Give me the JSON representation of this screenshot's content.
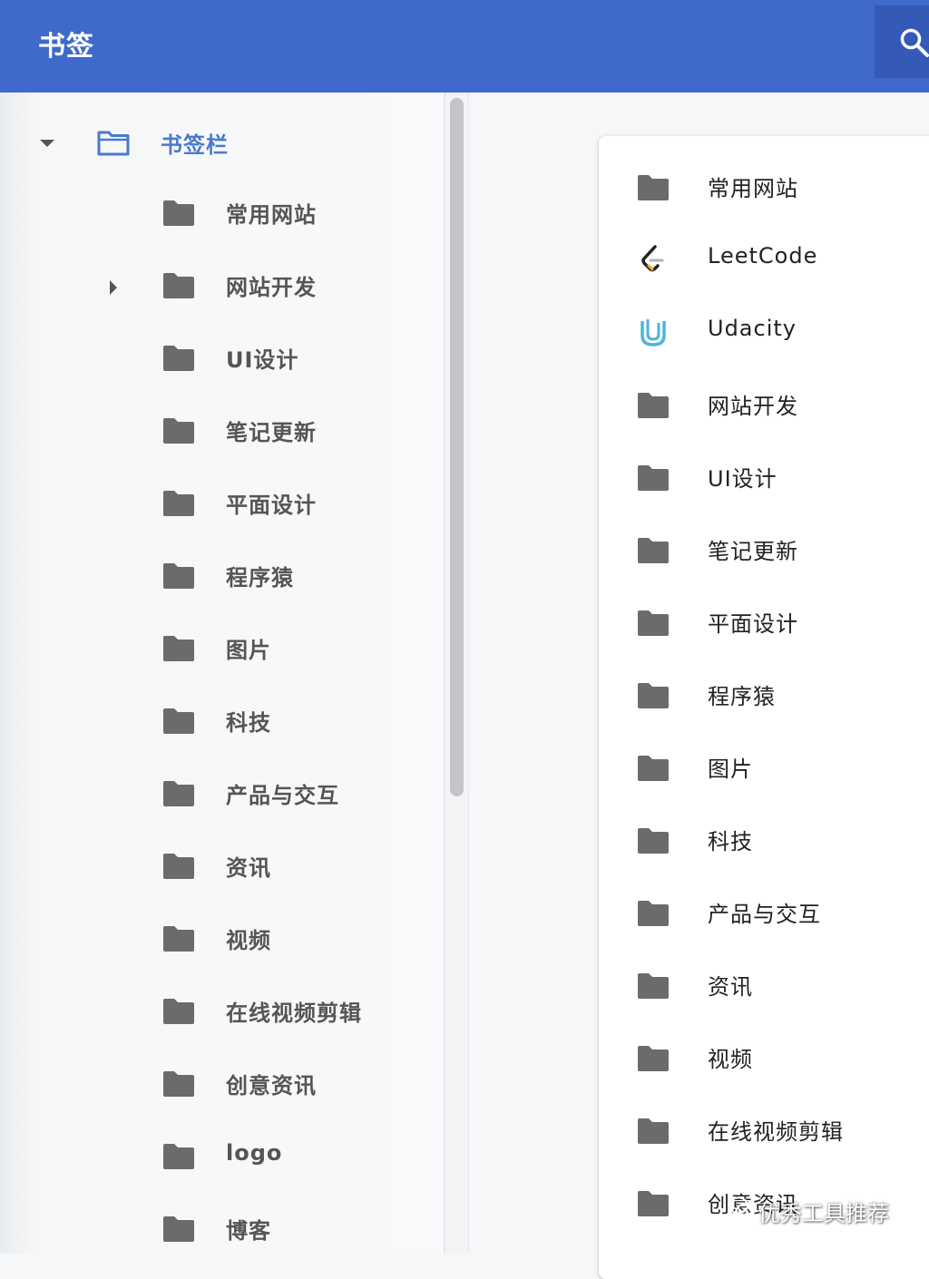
{
  "header": {
    "title": "书签"
  },
  "sidebar": {
    "root_label": "书签栏",
    "items": [
      {
        "label": "常用网站"
      },
      {
        "label": "网站开发",
        "expandable": true
      },
      {
        "label": "UI设计"
      },
      {
        "label": "笔记更新"
      },
      {
        "label": "平面设计"
      },
      {
        "label": "程序猿"
      },
      {
        "label": "图片"
      },
      {
        "label": "科技"
      },
      {
        "label": "产品与交互"
      },
      {
        "label": "资讯"
      },
      {
        "label": "视频"
      },
      {
        "label": "在线视频剪辑"
      },
      {
        "label": "创意资讯"
      },
      {
        "label": "logo"
      },
      {
        "label": "博客"
      }
    ]
  },
  "main": {
    "items": [
      {
        "label": "常用网站",
        "icon": "folder-icon"
      },
      {
        "label": "LeetCode",
        "icon": "leetcode-icon"
      },
      {
        "label": "Udacity",
        "icon": "udacity-icon"
      },
      {
        "label": "网站开发",
        "icon": "folder-icon"
      },
      {
        "label": "UI设计",
        "icon": "folder-icon"
      },
      {
        "label": "笔记更新",
        "icon": "folder-icon"
      },
      {
        "label": "平面设计",
        "icon": "folder-icon"
      },
      {
        "label": "程序猿",
        "icon": "folder-icon"
      },
      {
        "label": "图片",
        "icon": "folder-icon"
      },
      {
        "label": "科技",
        "icon": "folder-icon"
      },
      {
        "label": "产品与交互",
        "icon": "folder-icon"
      },
      {
        "label": "资讯",
        "icon": "folder-icon"
      },
      {
        "label": "视频",
        "icon": "folder-icon"
      },
      {
        "label": "在线视频剪辑",
        "icon": "folder-icon"
      },
      {
        "label": "创意资讯",
        "icon": "folder-icon"
      }
    ]
  },
  "watermark": {
    "text": "优秀工具推荐"
  },
  "colors": {
    "header": "#3f6acc",
    "accent": "#4a78d0",
    "folder": "#6b6b6b"
  }
}
